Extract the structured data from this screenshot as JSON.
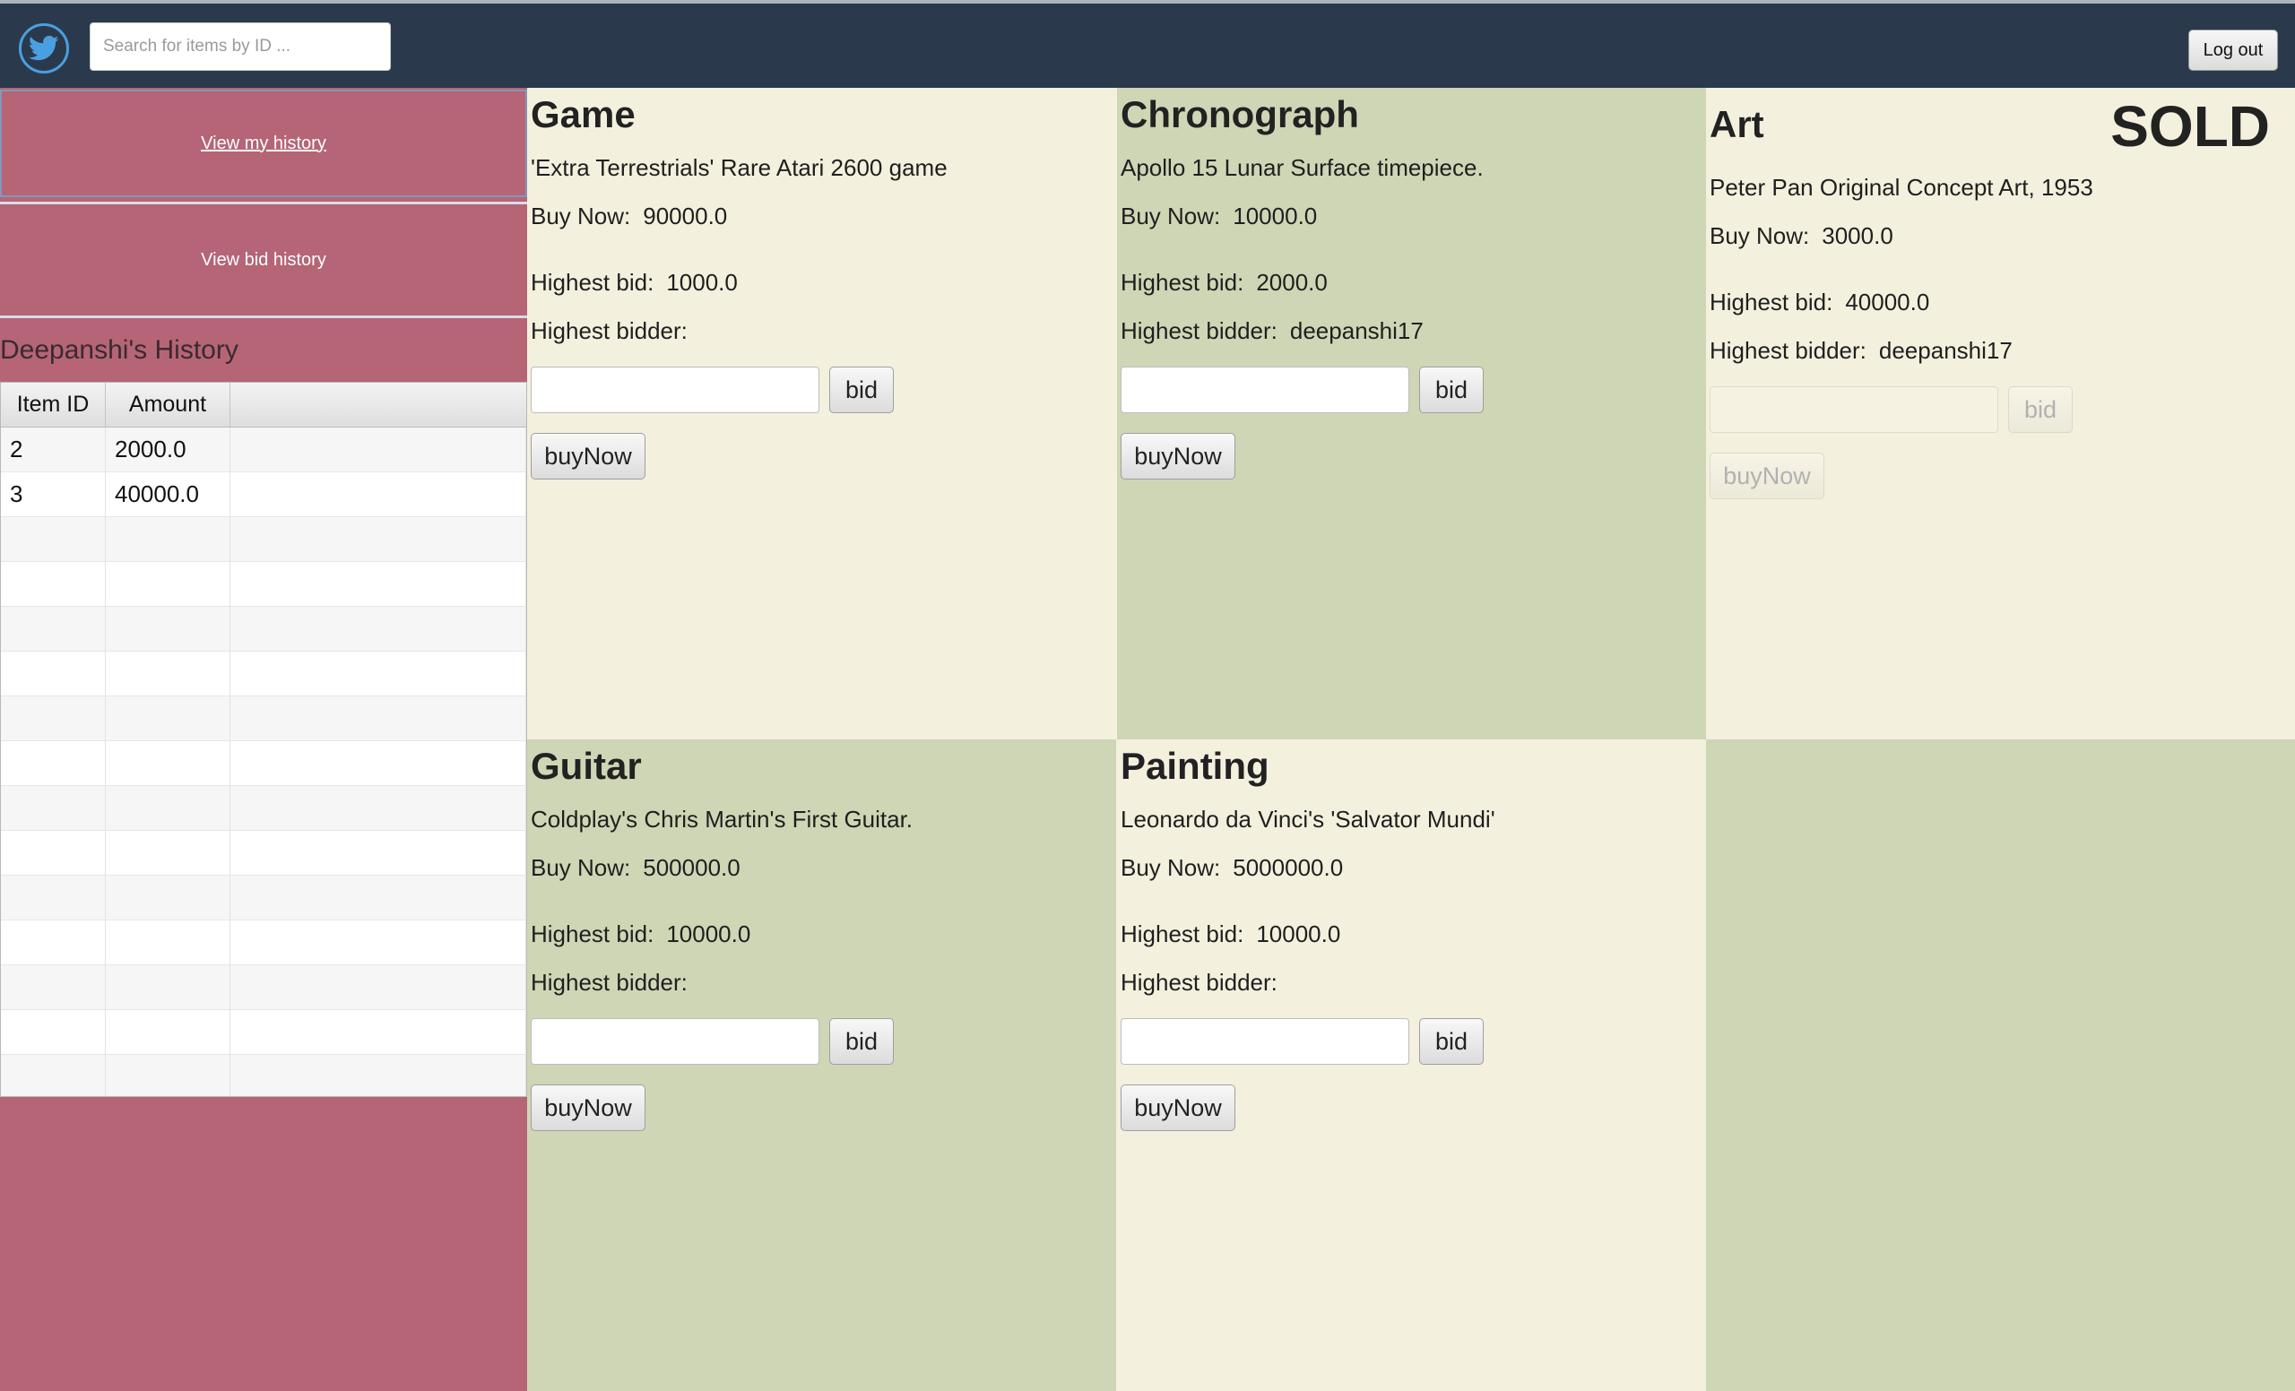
{
  "header": {
    "logo_icon": "twitter-bird-icon",
    "search_placeholder": "Search for items by ID ...",
    "logout_label": "Log out"
  },
  "sidebar": {
    "view_my_history_label": "View my history",
    "view_bid_history_label": "View bid history",
    "history_title": "Deepanshi's History",
    "table": {
      "columns": [
        "Item ID",
        "Amount",
        ""
      ],
      "rows": [
        [
          "2",
          "2000.0",
          ""
        ],
        [
          "3",
          "40000.0",
          ""
        ]
      ]
    }
  },
  "labels": {
    "buy_now": "Buy Now:",
    "highest_bid": "Highest bid:",
    "highest_bidder": "Highest bidder:",
    "bid_button": "bid",
    "buy_now_button": "buyNow"
  },
  "items": [
    {
      "title": "Game",
      "description": "'Extra Terrestrials' Rare Atari 2600 game",
      "buy_now": "90000.0",
      "highest_bid": "1000.0",
      "highest_bidder": "",
      "sold_label": "",
      "bid_value": ""
    },
    {
      "title": "Chronograph",
      "description": "Apollo 15 Lunar Surface timepiece.",
      "buy_now": "10000.0",
      "highest_bid": "2000.0",
      "highest_bidder": "deepanshi17",
      "sold_label": "",
      "bid_value": ""
    },
    {
      "title": "Art",
      "description": "Peter Pan Original Concept Art, 1953",
      "buy_now": "3000.0",
      "highest_bid": "40000.0",
      "highest_bidder": "deepanshi17",
      "sold_label": "SOLD",
      "bid_value": ""
    },
    {
      "title": "Guitar",
      "description": "Coldplay's Chris Martin's First Guitar.",
      "buy_now": "500000.0",
      "highest_bid": "10000.0",
      "highest_bidder": "",
      "sold_label": "",
      "bid_value": ""
    },
    {
      "title": "Painting",
      "description": "Leonardo da Vinci's 'Salvator Mundi'",
      "buy_now": "5000000.0",
      "highest_bid": "10000.0",
      "highest_bidder": "",
      "sold_label": "",
      "bid_value": ""
    }
  ],
  "colors": {
    "header_bg": "#2a3a4c",
    "sidebar_bg": "#b56576",
    "card_light": "#f3f0de",
    "card_green": "#cfd6b5"
  }
}
